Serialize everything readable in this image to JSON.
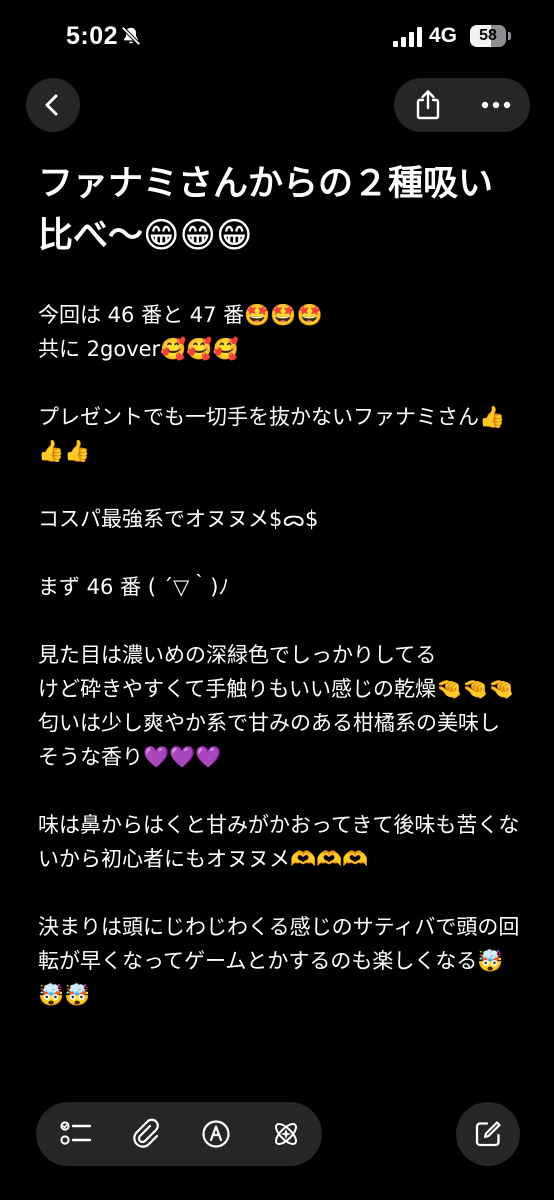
{
  "status_bar": {
    "time": "5:02",
    "network": "4G",
    "battery_level": "58",
    "battery_fraction": 0.58,
    "silent_icon": "bell-slash-icon",
    "signal_icon": "cellular-signal-icon"
  },
  "nav": {
    "back_icon": "chevron-left-icon",
    "share_icon": "share-icon",
    "more_icon": "ellipsis-icon"
  },
  "note": {
    "title": "ファナミさんからの２種吸い比べ〜😁😁😁",
    "lines": [
      "今回は 46 番と 47 番🤩🤩🤩",
      "共に 2gover🥰🥰🥰",
      "",
      "プレゼントでも一切手を抜かないファナミさん👍👍👍",
      "",
      "コスパ最強系でオヌヌメ$ᯅ$",
      "",
      "まず 46 番 ( ´▽｀)ﾉ",
      "",
      "見た目は濃いめの深緑色でしっかりしてる",
      "けど砕きやすくて手触りもいい感じの乾燥🤏🤏🤏",
      "匂いは少し爽やか系で甘みのある柑橘系の美味しそうな香り💜💜💜",
      "",
      "味は鼻からはくと甘みがかおってきて後味も苦くないから初心者にもオヌヌメ🫶🫶🫶",
      "",
      "決まりは頭にじわじわくる感じのサティバで頭の回転が早くなってゲームとかするのも楽しくなる🤯🤯🤯"
    ]
  },
  "toolbar": {
    "checklist_icon": "checklist-icon",
    "attachment_icon": "paperclip-icon",
    "markup_icon": "pen-markup-icon",
    "ai_icon": "sparkle-ai-icon",
    "compose_icon": "compose-icon"
  },
  "colors": {
    "background": "#000000",
    "surface": "#262626",
    "text": "#ffffff"
  }
}
